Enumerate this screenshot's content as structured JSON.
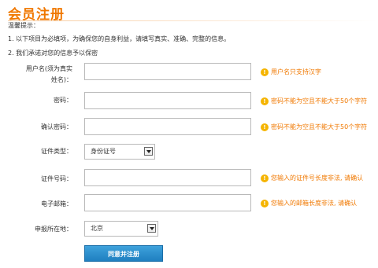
{
  "page": {
    "title": "会员注册"
  },
  "notice": {
    "heading": "温馨提示：",
    "line1": "1. 以下项目为必填项，为确保您的自身利益，请填写真实、准确、完整的信息。",
    "line2": "2. 我们承诺对您的信息予以保密"
  },
  "form": {
    "username": {
      "label_line1": "用户名(须为真实",
      "label_line2": "姓名)：",
      "value": "",
      "hint": "用户名只支持汉字"
    },
    "password": {
      "label": "密码：",
      "value": "",
      "hint": "密码不能为空且不能大于50个字符"
    },
    "confirm_password": {
      "label": "确认密码：",
      "value": "",
      "hint": "密码不能为空且不能大于50个字符"
    },
    "id_type": {
      "label": "证件类型：",
      "selected": "身份证号"
    },
    "id_number": {
      "label": "证件号码：",
      "value": "",
      "hint": "您输入的证件号长度非法, 请确认"
    },
    "email": {
      "label": "电子邮箱：",
      "value": "",
      "hint": "您输入的邮箱长度非法, 请确认"
    },
    "region": {
      "label": "申报所在地：",
      "selected": "北京"
    },
    "submit_label": "同意并注册"
  },
  "icons": {
    "hint": "warning-circle-icon",
    "dropdown": "chevron-down-icon"
  },
  "colors": {
    "accent": "#f07800",
    "button": "#2a8fd0",
    "hint_icon": "#f5b400"
  }
}
